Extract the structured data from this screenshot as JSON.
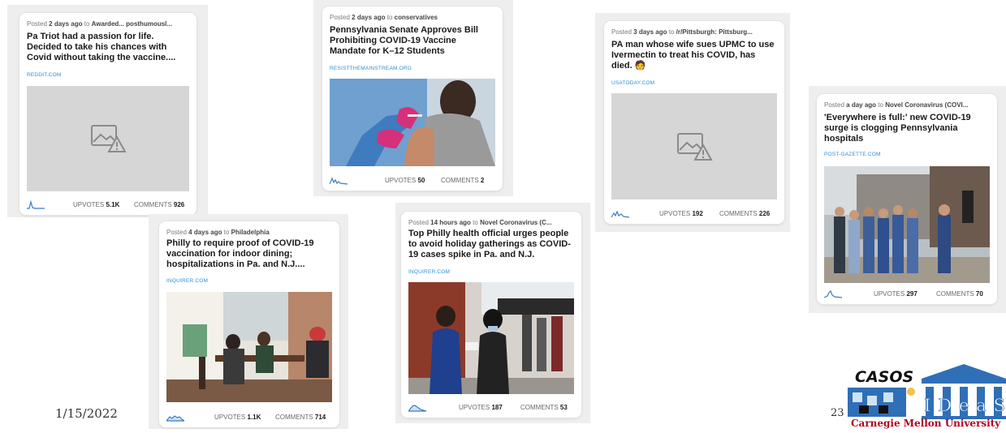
{
  "slide": {
    "date": "1/15/2022",
    "page_number": "23",
    "footer_org": "Carnegie Mellon University",
    "logo_left": "CASOS",
    "logo_right": "IDeaS"
  },
  "posts": [
    {
      "posted_ago": "2 days ago",
      "community": "Awarded... posthumousl...",
      "title": "Pa Triot had a passion for life. Decided to take his chances with Covid without taking the vaccine....",
      "domain": "REDDIT.COM",
      "image": "broken-image-icon",
      "upvotes": "5.1K",
      "comments": "926"
    },
    {
      "posted_ago": "2 days ago",
      "community": "conservatives",
      "title": "Pennsylvania Senate Approves Bill Prohibiting COVID-19 Vaccine Mandate for K–12 Students",
      "domain": "RESISTTHEMAINSTREAM.ORG",
      "image": "vaccination-photo",
      "upvotes": "50",
      "comments": "2"
    },
    {
      "posted_ago": "3 days ago",
      "community": "/r/Pittsburgh: Pittsburg...",
      "title": "PA man whose wife sues UPMC to use Ivermectin to treat his COVID, has died.",
      "domain": "USATODAY.COM",
      "image": "broken-image-icon",
      "upvotes": "192",
      "comments": "226"
    },
    {
      "posted_ago": "a day ago",
      "community": "Novel Coronavirus (COVI...",
      "title": "'Everywhere is full:' new COVID-19 surge is clogging Pennsylvania hospitals",
      "domain": "POST-GAZETTE.COM",
      "image": "press-conference-photo",
      "upvotes": "297",
      "comments": "70"
    },
    {
      "posted_ago": "4 days ago",
      "community": "Philadelphia",
      "title": "Philly to require proof of COVID-19 vaccination for indoor dining; hospitalizations in Pa. and N.J....",
      "domain": "INQUIRER.COM",
      "image": "restaurant-dining-photo",
      "upvotes": "1.1K",
      "comments": "714"
    },
    {
      "posted_ago": "14 hours ago",
      "community": "Novel Coronavirus (C...",
      "title": "Top Philly health official urges people to avoid holiday gatherings as COVID-19 cases spike in Pa. and N.J.",
      "domain": "INQUIRER.COM",
      "image": "testing-line-photo",
      "upvotes": "187",
      "comments": "53"
    }
  ],
  "labels": {
    "posted": "Posted",
    "to": "to",
    "upvotes": "UPVOTES",
    "comments": "COMMENTS"
  }
}
